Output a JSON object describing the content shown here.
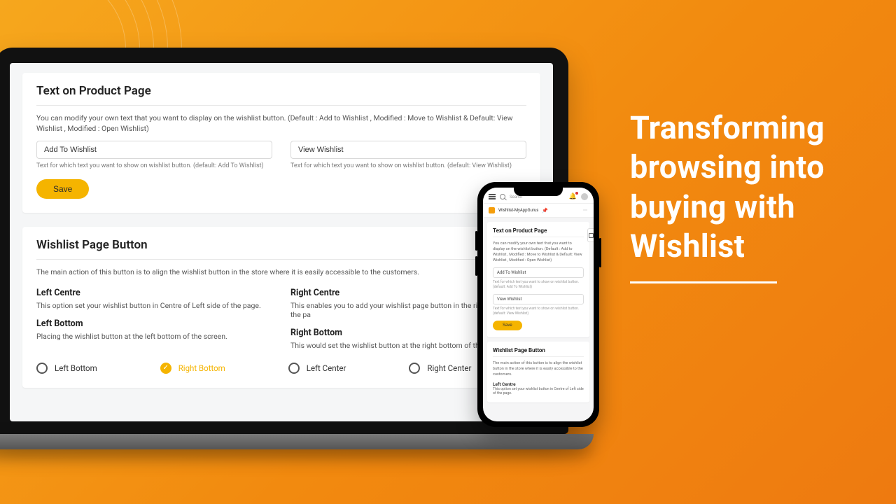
{
  "headline": "Transforming browsing into buying with Wishlist",
  "desktop": {
    "card1": {
      "title": "Text on Product Page",
      "desc": "You can modify your own text that you want to display on the wishlist button. (Default : Add to Wishlist , Modified : Move to Wishlist & Default: View Wishlist , Modified : Open Wishlist)",
      "input1": "Add To Wishlist",
      "help1": "Text for which text you want to show on wishlist button. (default: Add To Wishlist)",
      "input2": "View Wishlist",
      "help2": "Text for which text you want to show on wishlist button. (default: View Wishlist)",
      "save": "Save"
    },
    "card2": {
      "title": "Wishlist Page Button",
      "desc": "The main action of this button is to align the wishlist button in the store where it is easily accessible to the customers.",
      "options": {
        "lc_head": "Left Centre",
        "lc_desc": "This option set your wishlist button in Centre of Left side of the page.",
        "rc_head": "Right Centre",
        "rc_desc": "This enables you to add your wishlist page button in the right-centre of the pa",
        "lb_head": "Left Bottom",
        "lb_desc": "Placing the wishlist button at the left bottom of the screen.",
        "rb_head": "Right Bottom",
        "rb_desc": "This would set the wishlist button at the right bottom of the screen."
      },
      "radios": {
        "r1": "Left Bottom",
        "r2": "Right Bottom",
        "r3": "Left Center",
        "r4": "Right Center",
        "selected": "r2"
      }
    }
  },
  "phone": {
    "search_placeholder": "Search",
    "brand": "Wishlist-MyAppGurus",
    "card1": {
      "title": "Text on Product Page",
      "desc": "You can modify your own text that you want to display on the wishlist button. (Default : Add to Wishlist , Modified : Move to Wishlist & Default: View Wishlist , Modified : Open Wishlist)",
      "input1": "Add To Wishlist",
      "help1": "Text for which text you want to show on wishlist button. (default: Add To Wishlist)",
      "input2": "View Wishlist",
      "help2": "Text for which text you want to show on wishlist button. (default: View Wishlist)",
      "save": "Save"
    },
    "card2": {
      "title": "Wishlist Page Button",
      "desc": "The main action of this button is to align the wishlist button in the store where it is easily accessible to the customers.",
      "lc_head": "Left Centre",
      "lc_desc": "This option set your wishlist button in Centre of Left side of the page."
    }
  }
}
